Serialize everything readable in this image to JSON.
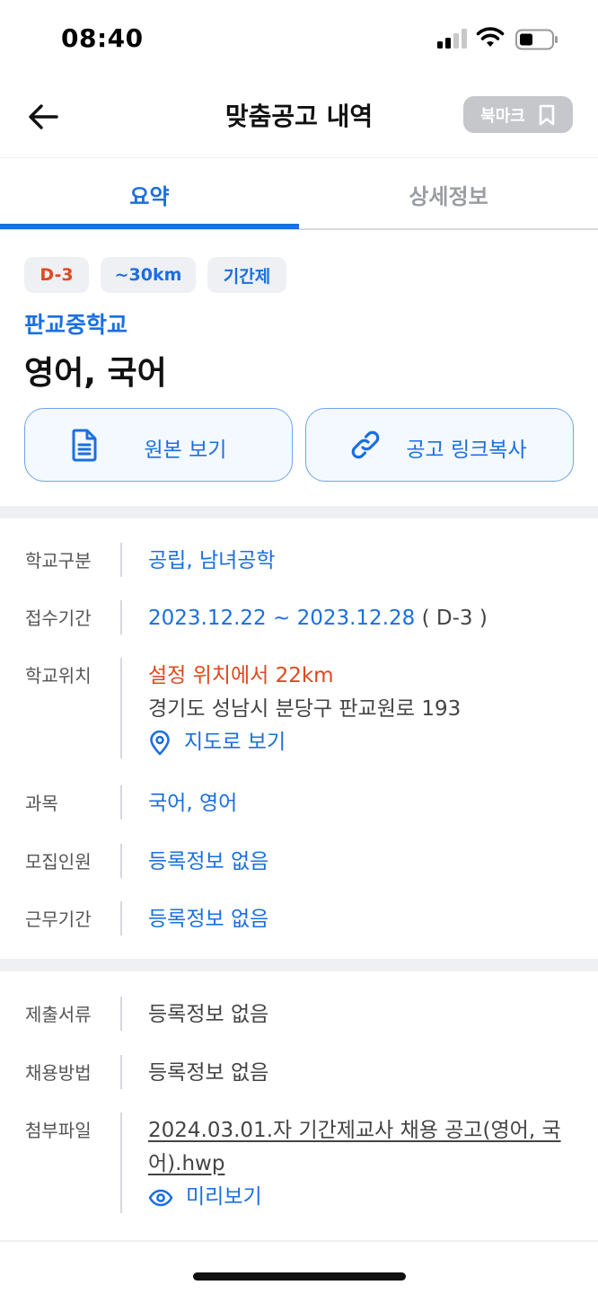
{
  "status_bar": {
    "time": "08:40"
  },
  "header": {
    "title": "맞춤공고 내역",
    "bookmark_label": "북마크"
  },
  "tabs": [
    {
      "label": "요약",
      "active": true
    },
    {
      "label": "상세정보",
      "active": false
    }
  ],
  "summary": {
    "chips": {
      "dday": "D-3",
      "distance": "~30km",
      "type": "기간제"
    },
    "school_name": "판교중학교",
    "subject_title": "영어, 국어",
    "view_original_label": "원본 보기",
    "copy_link_label": "공고 링크복사"
  },
  "details": {
    "school_type": {
      "label": "학교구분",
      "value": "공립, 남녀공학"
    },
    "period": {
      "label": "접수기간",
      "value": "2023.12.22 ~ 2023.12.28",
      "suffix": " ( D-3 )"
    },
    "location": {
      "label": "학교위치",
      "distance": "설정 위치에서 22km",
      "address": "경기도 성남시 분당구 판교원로 193",
      "map_link": "지도로 보기"
    },
    "subject": {
      "label": "과목",
      "value": "국어, 영어"
    },
    "recruit": {
      "label": "모집인원",
      "value": "등록정보 없음"
    },
    "work_period": {
      "label": "근무기간",
      "value": "등록정보 없음"
    }
  },
  "extra": {
    "documents": {
      "label": "제출서류",
      "value": "등록정보 없음"
    },
    "method": {
      "label": "채용방법",
      "value": "등록정보 없음"
    },
    "attachment": {
      "label": "첨부파일",
      "file_name": "2024.03.01.자 기간제교사 채용 공고(영어, 국어).hwp",
      "preview_label": "미리보기"
    }
  },
  "colors": {
    "accent": "#1b6fe0",
    "dday": "#e0481f",
    "bookmark_bg": "#c5c7cb"
  },
  "icons": [
    "back-arrow-icon",
    "bookmark-icon",
    "document-icon",
    "link-icon",
    "location-pin-icon",
    "eye-icon",
    "signal-icon",
    "wifi-icon",
    "battery-icon"
  ]
}
